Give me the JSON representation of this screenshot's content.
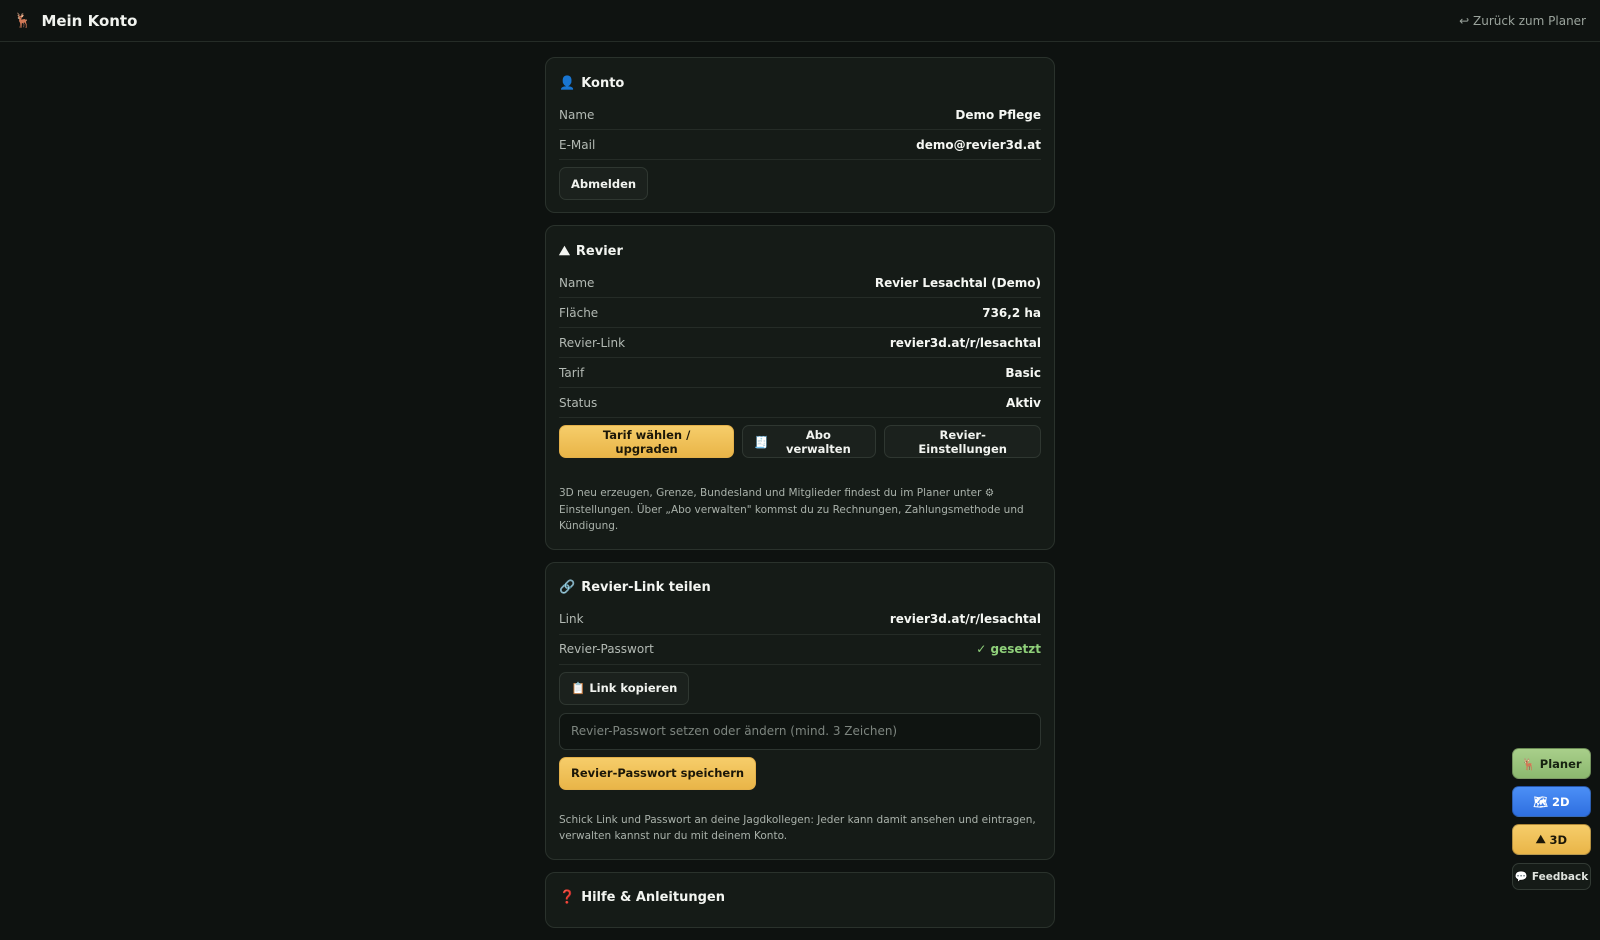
{
  "header": {
    "logo_icon": "deer-icon",
    "title": "Mein Konto",
    "back_link": "↩ Zurück zum Planer"
  },
  "konto": {
    "title": "Konto",
    "icon": "user-icon",
    "rows": [
      {
        "label": "Name",
        "value": "Demo Pflege"
      },
      {
        "label": "E-Mail",
        "value": "demo@revier3d.at"
      }
    ],
    "logout_label": "Abmelden"
  },
  "revier": {
    "title": "Revier",
    "icon": "mountain-icon",
    "rows": [
      {
        "label": "Name",
        "value": "Revier Lesachtal (Demo)"
      },
      {
        "label": "Fläche",
        "value": "736,2 ha"
      },
      {
        "label": "Revier-Link",
        "value": "revier3d.at/r/lesachtal"
      },
      {
        "label": "Tarif",
        "value": "Basic"
      },
      {
        "label": "Status",
        "value": "Aktiv"
      }
    ],
    "buttons": {
      "upgrade": "Tarif wählen / upgraden",
      "abo": "Abo verwalten",
      "settings": "Revier-Einstellungen"
    },
    "note": "3D neu erzeugen, Grenze, Bundesland und Mitglieder findest du im Planer unter ⚙ Einstellungen. Über „Abo verwalten\" kommst du zu Rechnungen, Zahlungsmethode und Kündigung."
  },
  "share": {
    "title": "Revier-Link teilen",
    "icon": "link-icon",
    "rows": [
      {
        "label": "Link",
        "value": "revier3d.at/r/lesachtal"
      },
      {
        "label": "Revier-Passwort",
        "value": "✓ gesetzt"
      }
    ],
    "copy_label": "Link kopieren",
    "password_placeholder": "Revier-Passwort setzen oder ändern (mind. 3 Zeichen)",
    "save_label": "Revier-Passwort speichern",
    "note": "Schick Link und Passwort an deine Jagdkollegen: Jeder kann damit ansehen und eintragen, verwalten kannst nur du mit deinem Konto."
  },
  "help": {
    "title": "Hilfe & Anleitungen",
    "icon": "question-icon"
  },
  "floating": {
    "planer": "Planer",
    "two_d": "2D",
    "three_d": "3D",
    "feedback": "Feedback"
  }
}
